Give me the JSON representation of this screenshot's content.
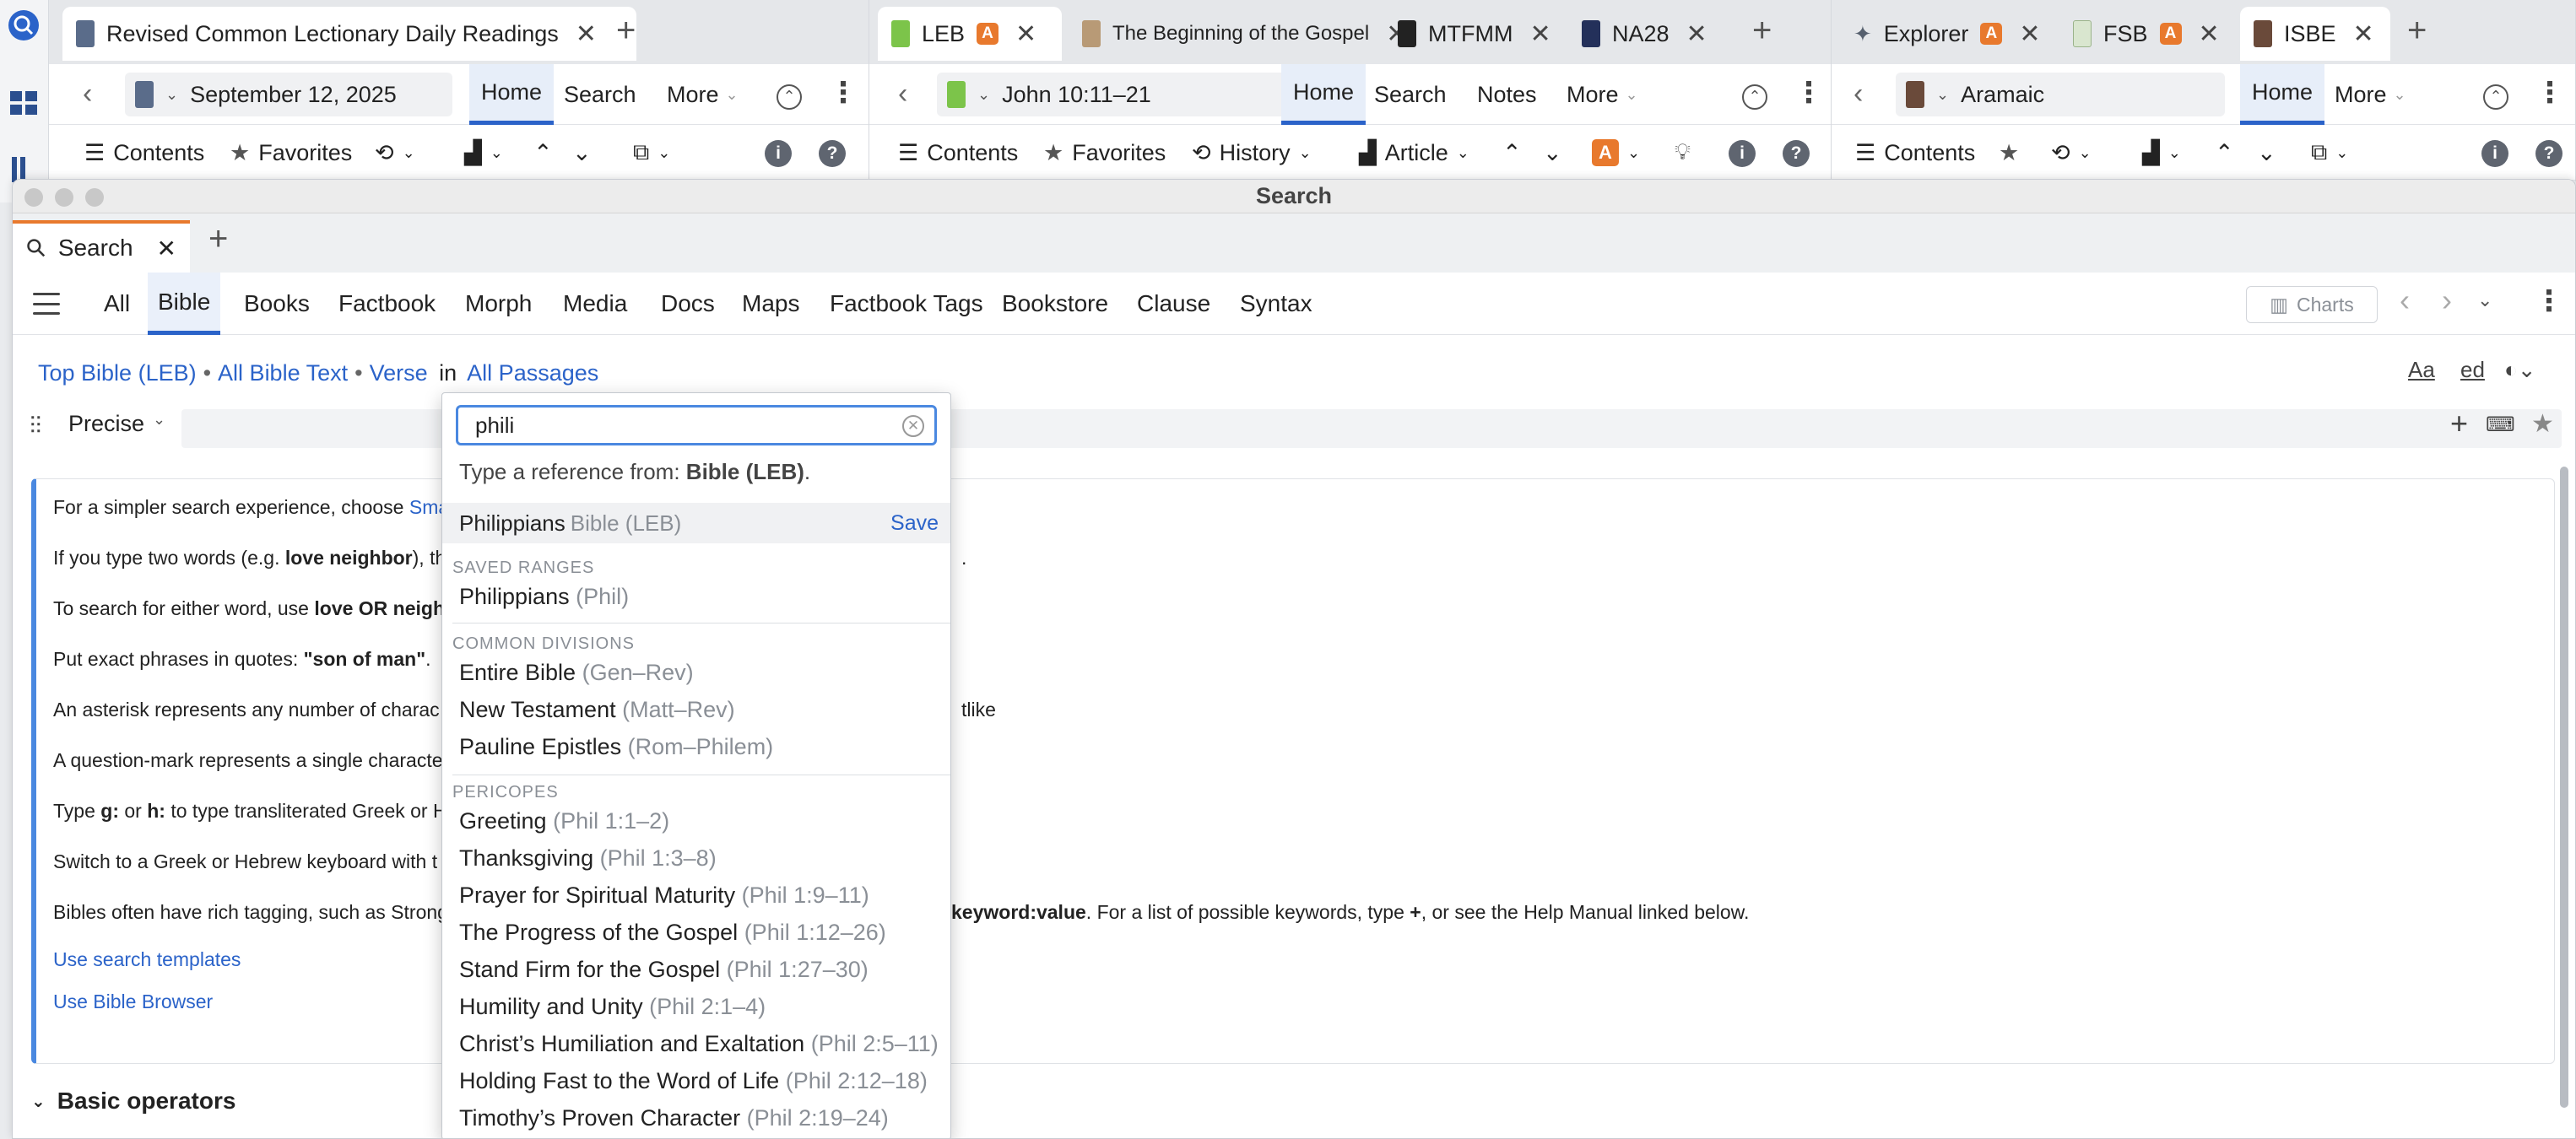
{
  "panels": [
    {
      "tabs": [
        {
          "label": "Revised Common Lectionary Daily Readings"
        }
      ],
      "reference": "September 12, 2025",
      "nav": [
        "Home",
        "Search",
        "More"
      ],
      "tools": [
        "Contents",
        "Favorites"
      ]
    },
    {
      "tabs": [
        {
          "label": "LEB"
        },
        {
          "label": "The Beginning of the Gospel"
        },
        {
          "label": "MTFMM"
        },
        {
          "label": "NA28"
        }
      ],
      "reference": "John 10:11–21",
      "nav": [
        "Home",
        "Search",
        "Notes",
        "More"
      ],
      "tools": [
        "Contents",
        "Favorites",
        "History",
        "Article"
      ]
    },
    {
      "tabs": [
        {
          "label": "Explorer"
        },
        {
          "label": "FSB"
        },
        {
          "label": "ISBE"
        }
      ],
      "reference": "Aramaic",
      "nav": [
        "Home",
        "More"
      ],
      "tools": [
        "Contents"
      ]
    }
  ],
  "badge_letter": "A",
  "info_glyph": "i",
  "help_glyph": "?",
  "search_window": {
    "title": "Search",
    "tab_label": "Search",
    "categories": [
      "All",
      "Bible",
      "Books",
      "Factbook",
      "Morph",
      "Media",
      "Docs",
      "Maps",
      "Factbook Tags",
      "Bookstore",
      "Clause",
      "Syntax"
    ],
    "active_category": "Bible",
    "charts_label": "Charts",
    "scope": {
      "bible": "Top Bible (LEB)",
      "text": "All Bible Text",
      "unit": "Verse",
      "in": "in",
      "range": "All Passages"
    },
    "mode": "Precise",
    "font_button": "Aa",
    "ed_button": "ed"
  },
  "help": {
    "lines": [
      {
        "pre": "For a simpler search experience, choose ",
        "link": "Sma"
      },
      {
        "pre": "If you type two words (e.g. ",
        "bold": "love neighbor",
        "post": "), th"
      },
      {
        "pre": "To search for either word, use ",
        "bold": "love OR neigh"
      },
      {
        "pre": "Put exact phrases in quotes: ",
        "bold": "\"son of man\"",
        "post": "."
      },
      {
        "pre": "An asterisk represents any number of charac",
        "tail": "tlike"
      },
      {
        "pre": "A question-mark represents a single characte"
      },
      {
        "pre": "Type ",
        "bold": "g:",
        "mid": " or ",
        "bold2": "h:",
        "post": " to type transliterated Greek or H"
      },
      {
        "pre": "Switch to a Greek or Hebrew keyboard with t"
      },
      {
        "pre": "Bibles often have rich tagging, such as Strong",
        "bold": "keyword:value",
        "post": ". For a list of possible keywords, type ",
        "bold2": "+",
        "post2": ", or see the Help Manual linked below."
      }
    ],
    "links": [
      "Use search templates",
      "Use Bible Browser"
    ]
  },
  "basic_operators": "Basic operators",
  "dropdown": {
    "input_value": "phili",
    "hint_prefix": "Type a reference from: ",
    "hint_bold": "Bible (LEB)",
    "hint_suffix": ".",
    "top_option": {
      "name": "Philippians",
      "source": "Bible (LEB)",
      "action": "Save"
    },
    "groups": [
      {
        "header": "SAVED RANGES",
        "items": [
          {
            "name": "Philippians",
            "range": "(Phil)"
          }
        ]
      },
      {
        "header": "COMMON DIVISIONS",
        "items": [
          {
            "name": "Entire Bible",
            "range": "(Gen–Rev)"
          },
          {
            "name": "New Testament",
            "range": "(Matt–Rev)"
          },
          {
            "name": "Pauline Epistles",
            "range": "(Rom–Philem)"
          }
        ]
      },
      {
        "header": "PERICOPES",
        "items": [
          {
            "name": "Greeting",
            "range": "(Phil 1:1–2)"
          },
          {
            "name": "Thanksgiving",
            "range": "(Phil 1:3–8)"
          },
          {
            "name": "Prayer for Spiritual Maturity",
            "range": "(Phil 1:9–11)"
          },
          {
            "name": "The Progress of the Gospel",
            "range": "(Phil 1:12–26)"
          },
          {
            "name": "Stand Firm for the Gospel",
            "range": "(Phil 1:27–30)"
          },
          {
            "name": "Humility and Unity",
            "range": "(Phil 2:1–4)"
          },
          {
            "name": "Christ’s Humiliation and Exaltation",
            "range": "(Phil 2:5–11)"
          },
          {
            "name": "Holding Fast to the Word of Life",
            "range": "(Phil 2:12–18)"
          },
          {
            "name": "Timothy’s Proven Character",
            "range": "(Phil 2:19–24)"
          }
        ]
      }
    ]
  },
  "colors": {
    "accent": "#2b63c9",
    "orange": "#e8792d",
    "focus": "#4a88e0"
  }
}
